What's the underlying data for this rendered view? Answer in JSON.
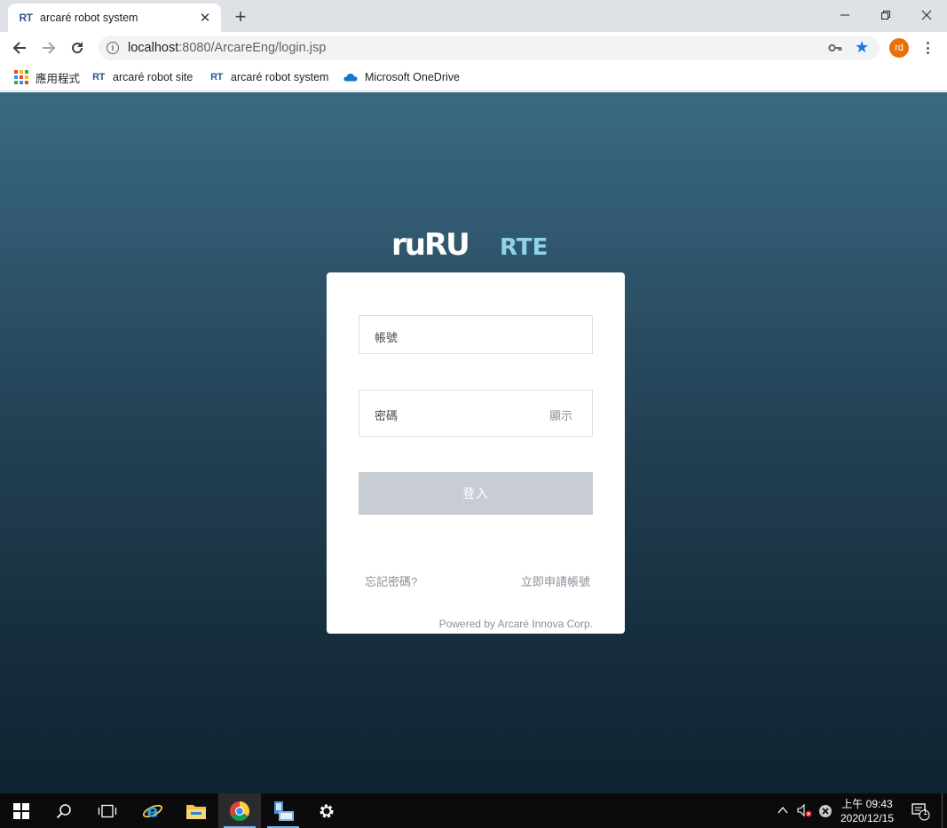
{
  "browser": {
    "tab": {
      "favicon": "RT",
      "title": "arcaré robot system"
    },
    "url": {
      "host": "localhost",
      "rest": ":8080/ArcareEng/login.jsp"
    },
    "profile_initials": "rd",
    "bookmarks": [
      {
        "icon": "apps-grid-icon",
        "label": "應用程式"
      },
      {
        "icon": "RT",
        "label": "arcaré robot site"
      },
      {
        "icon": "RT",
        "label": "arcaré robot system"
      },
      {
        "icon": "onedrive-cloud-icon",
        "label": "Microsoft OneDrive"
      }
    ]
  },
  "login": {
    "logo_text": "ruRU",
    "logo_suffix": "RTE",
    "account_label": "帳號",
    "password_label": "密碼",
    "show_label": "顯示",
    "submit_label": "登入",
    "forgot_label": "忘記密碼?",
    "register_label": "立即申請帳號",
    "powered_by": "Powered by Arcaré Innova Corp."
  },
  "taskbar": {
    "time_period": "上午",
    "time": "09:43",
    "date": "2020/12/15",
    "notification_count": "1"
  },
  "colors": {
    "accent": "#1a73e8",
    "button_disabled": "#c8cdd4",
    "bg_top": "#3a6a82",
    "bg_bottom": "#0f2330",
    "logo_suffix": "#8fd3ea"
  }
}
